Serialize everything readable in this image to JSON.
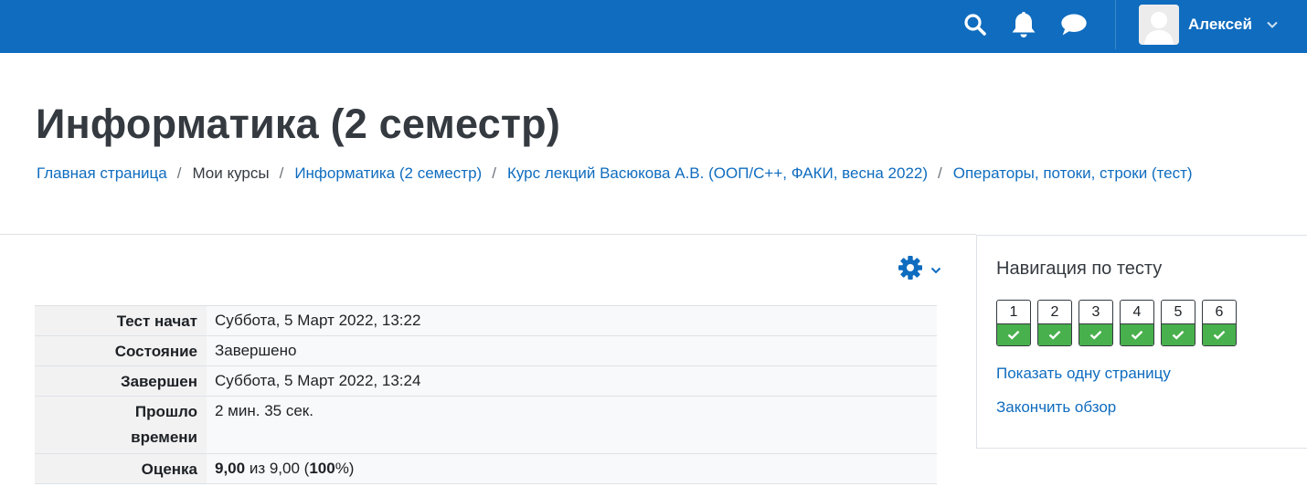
{
  "navbar": {
    "bg_color": "#0f6cbf",
    "icons": [
      "search-icon",
      "bell-icon",
      "message-icon"
    ],
    "user": {
      "name": "Алексей",
      "avatar": "default-user-avatar"
    }
  },
  "header": {
    "title": "Информатика (2 семестр)",
    "breadcrumb": [
      {
        "label": "Главная страница",
        "link": true
      },
      {
        "label": "Мои курсы",
        "link": false
      },
      {
        "label": "Информатика (2 семестр)",
        "link": true
      },
      {
        "label": "Курс лекций Васюкова А.В. (ООП/C++, ФАКИ, весна 2022)",
        "link": true
      },
      {
        "label": "Операторы, потоки, строки (тест)",
        "link": true
      }
    ],
    "separator": "/"
  },
  "settings_menu": {
    "icon": "gear-icon"
  },
  "summary": {
    "rows": [
      {
        "label": "Тест начат",
        "value": "Суббота, 5 Март 2022, 13:22"
      },
      {
        "label": "Состояние",
        "value": "Завершено"
      },
      {
        "label": "Завершен",
        "value": "Суббота, 5 Март 2022, 13:24"
      },
      {
        "label_line1": "Прошло",
        "label_line2": "времени",
        "value": "2 мин. 35 сек."
      },
      {
        "label": "Оценка",
        "grade": "9,00",
        "of_text": " из 9,00 (",
        "percent": "100",
        "close": "%)"
      }
    ]
  },
  "quiz_navigation": {
    "title": "Навигация по тесту",
    "questions": [
      {
        "number": "1",
        "state": "correct"
      },
      {
        "number": "2",
        "state": "correct"
      },
      {
        "number": "3",
        "state": "correct"
      },
      {
        "number": "4",
        "state": "correct"
      },
      {
        "number": "5",
        "state": "correct"
      },
      {
        "number": "6",
        "state": "correct"
      }
    ],
    "correct_color": "#48b04c",
    "show_one_page": "Показать одну страницу",
    "finish_review": "Закончить обзор"
  }
}
